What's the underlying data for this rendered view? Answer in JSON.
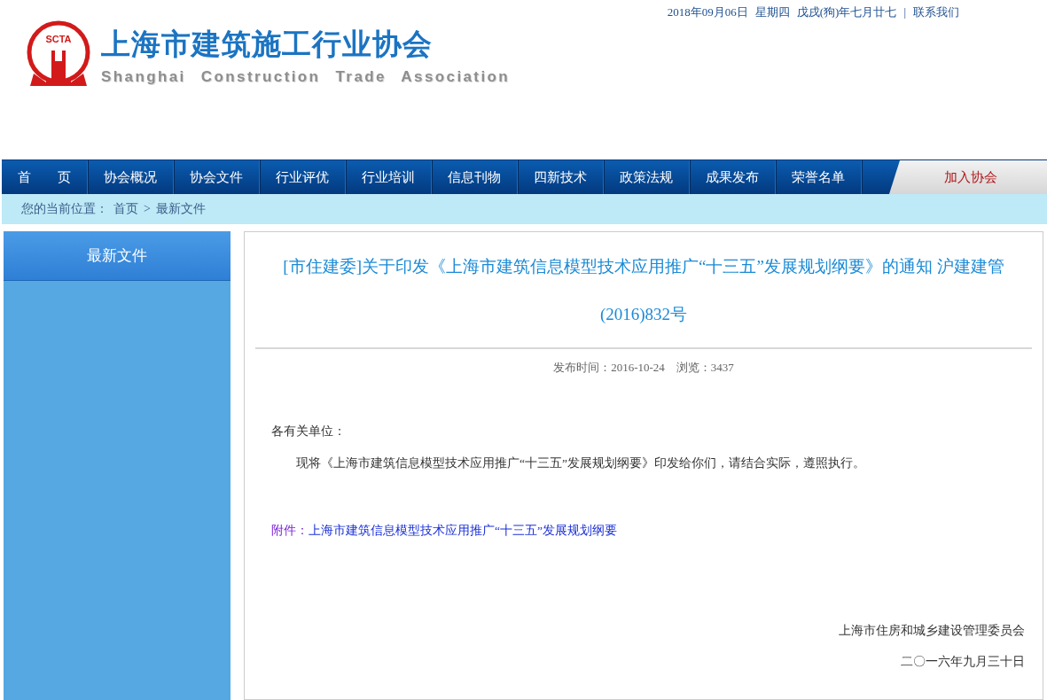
{
  "top_bar": {
    "date": "2018年09月06日",
    "weekday": "星期四",
    "lunar": "戊戌(狗)年七月廿七",
    "separator": "|",
    "contact_link": "联系我们"
  },
  "logo": {
    "badge": "SCTA",
    "title": "上海市建筑施工行业协会",
    "subtitle": "Shanghai Construction Trade Association"
  },
  "nav": {
    "items": [
      "首　　页",
      "协会概况",
      "协会文件",
      "行业评优",
      "行业培训",
      "信息刊物",
      "四新技术",
      "政策法规",
      "成果发布",
      "荣誉名单"
    ],
    "join_button": "加入协会"
  },
  "breadcrumb": {
    "label": "您的当前位置：",
    "items": [
      "首页",
      "最新文件"
    ],
    "separator": ">"
  },
  "sidebar": {
    "title": "最新文件"
  },
  "article": {
    "title": "[市住建委]关于印发《上海市建筑信息模型技术应用推广“十三五”发展规划纲要》的通知 沪建建管(2016)832号",
    "meta": "发布时间：2016-10-24　浏览：3437",
    "salutation": "各有关单位：",
    "body": "现将《上海市建筑信息模型技术应用推广“十三五”发展规划纲要》印发给你们，请结合实际，遵照执行。",
    "attachment_label": "附件：",
    "attachment_link": "上海市建筑信息模型技术应用推广“十三五”发展规划纲要",
    "signature": "上海市住房和城乡建设管理委员会",
    "date": "二〇一六年九月三十日"
  }
}
